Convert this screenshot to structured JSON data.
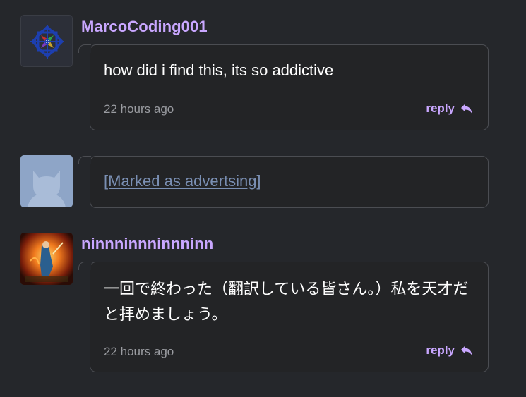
{
  "comments": [
    {
      "username": "MarcoCoding001",
      "text": "how did i find this, its so addictive",
      "timestamp": "22 hours ago",
      "reply_label": "reply",
      "avatar_icon": "compass-rose-avatar"
    },
    {
      "ad_label": "[Marked as advertsing]",
      "avatar_icon": "default-cat-avatar"
    },
    {
      "username": "ninnninnninnninn",
      "text": "一回で終わった（翻訳している皆さん。）私を天才だと拝めましょう。",
      "timestamp": "22 hours ago",
      "reply_label": "reply",
      "avatar_icon": "fiery-character-avatar"
    }
  ],
  "colors": {
    "background": "#25272b",
    "username": "#c9a7ff",
    "reply": "#c9a7ff",
    "timestamp": "#9a9ca1",
    "ad_link": "#7a8fb3",
    "border": "#4b4d52"
  }
}
